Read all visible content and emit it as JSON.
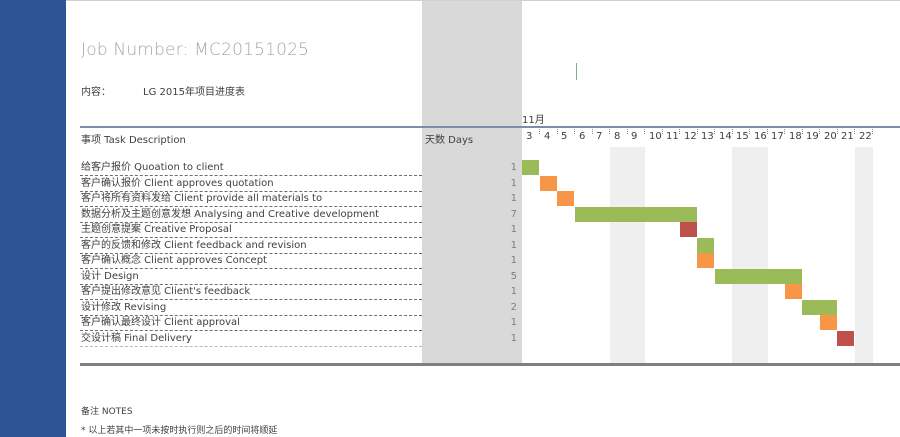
{
  "header": {
    "job_number": "Job Number: MC20151025",
    "content_label": "内容：",
    "content_value": "LG 2015年项目进度表"
  },
  "timeline": {
    "month": "11月",
    "task_header": "事项 Task Description",
    "days_header": "天数 Days",
    "days": [
      "3",
      "4",
      "5",
      "6",
      "7",
      "8",
      "9",
      "10",
      "11",
      "12",
      "13",
      "14",
      "15",
      "16",
      "17",
      "18",
      "19",
      "20",
      "21",
      "22"
    ],
    "weekend_days": [
      "8",
      "9",
      "15",
      "16",
      "22"
    ]
  },
  "colors": {
    "green": "#9bbb59",
    "orange": "#f79646",
    "red": "#c0504d",
    "sidebar": "#2f5496"
  },
  "tasks": [
    {
      "label": "给客户报价  Quoation to client",
      "days": "1",
      "start_day": "3",
      "end_day": "3",
      "color": "green"
    },
    {
      "label": "客户确认报价 Client approves quotation",
      "days": "1",
      "start_day": "4",
      "end_day": "4",
      "color": "orange"
    },
    {
      "label": "客户将所有资料发给 Client provide all materials to",
      "days": "1",
      "start_day": "5",
      "end_day": "5",
      "color": "orange"
    },
    {
      "label": "数据分析及主题创意发想 Analysing and Creative development",
      "days": "7",
      "start_day": "6",
      "end_day": "12",
      "color": "green"
    },
    {
      "label": "主题创意提案 Creative Proposal",
      "days": "1",
      "start_day": "12",
      "end_day": "12",
      "color": "red"
    },
    {
      "label": "客户的反馈和修改 Client feedback and revision",
      "days": "1",
      "start_day": "13",
      "end_day": "13",
      "color": "green"
    },
    {
      "label": "客户确认概念 Client approves Concept",
      "days": "1",
      "start_day": "13",
      "end_day": "13",
      "color": "orange"
    },
    {
      "label": "设计 Design",
      "days": "5",
      "start_day": "14",
      "end_day": "18",
      "color": "green"
    },
    {
      "label": "客户提出修改意见 Client's feedback",
      "days": "1",
      "start_day": "18",
      "end_day": "18",
      "color": "orange"
    },
    {
      "label": "设计修改 Revising",
      "days": "2",
      "start_day": "19",
      "end_day": "20",
      "color": "green"
    },
    {
      "label": "客户确认最终设计 Client approval",
      "days": "1",
      "start_day": "20",
      "end_day": "20",
      "color": "orange"
    },
    {
      "label": "交设计稿 Final Delivery",
      "days": "1",
      "start_day": "21",
      "end_day": "21",
      "color": "red"
    }
  ],
  "notes": {
    "title": "备注 NOTES",
    "line1": "* 以上若其中一项未按时执行则之后的时间将顺延"
  }
}
